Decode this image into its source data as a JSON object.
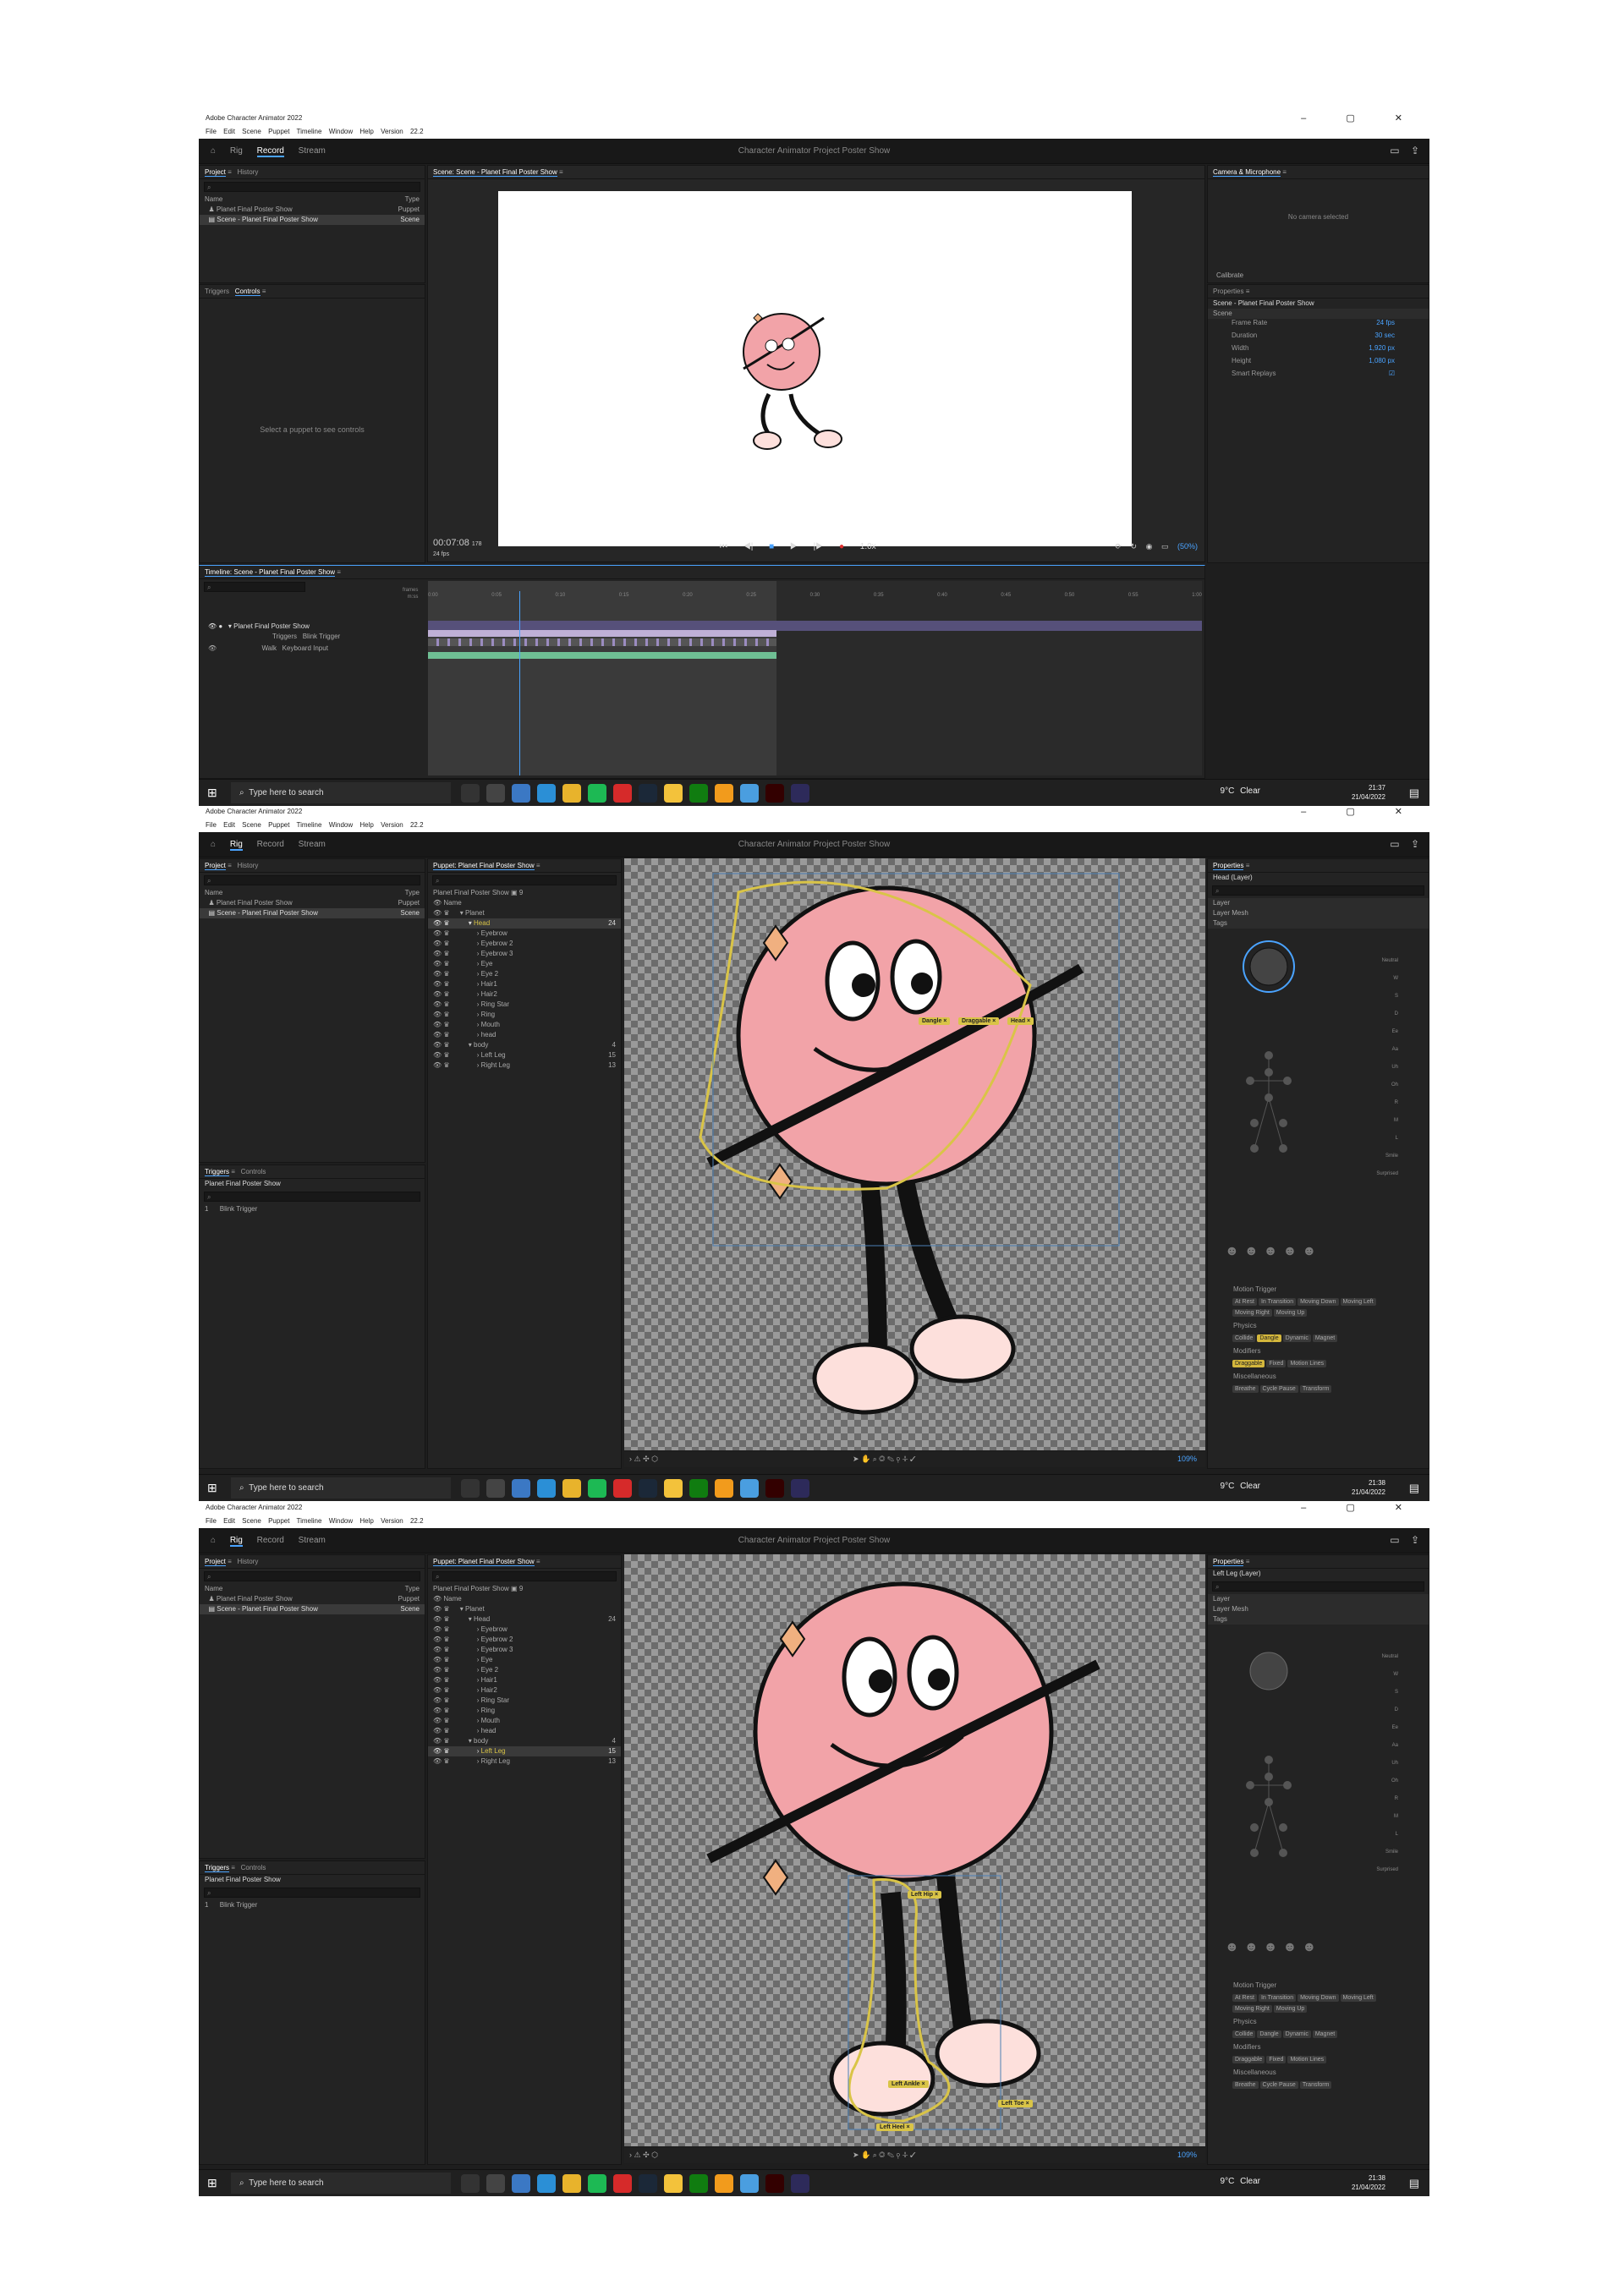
{
  "window": {
    "title": "Adobe Character Animator 2022",
    "controls": "–  ▢  ✕"
  },
  "menu": [
    "File",
    "Edit",
    "Scene",
    "Puppet",
    "Timeline",
    "Window",
    "Help",
    "Version 22.2"
  ],
  "header": {
    "tabs": [
      "Rig",
      "Record",
      "Stream"
    ],
    "project_title": "Character Animator Project Poster Show"
  },
  "project_panel": {
    "tabs": [
      "Project",
      "History"
    ],
    "col_name": "Name",
    "col_type": "Type",
    "rows": [
      {
        "name": "Planet Final Poster Show",
        "type": "Puppet"
      },
      {
        "name": "Scene - Planet Final Poster Show",
        "type": "Scene"
      }
    ]
  },
  "shot1": {
    "controls_panel": {
      "tabs": [
        "Triggers",
        "Controls"
      ],
      "message": "Select a puppet to see controls"
    },
    "scene_panel": {
      "title": "Scene: Scene - Planet Final Poster Show",
      "time": "00:07:08",
      "frame": "178",
      "fps": "24 fps",
      "speed": "1.0x",
      "zoom": "(50%)"
    },
    "camera_panel": {
      "title": "Camera & Microphone",
      "message": "No camera selected",
      "calibrate": "Calibrate"
    },
    "properties": {
      "title": "Properties",
      "scene_name": "Scene - Planet Final Poster Show",
      "section": "Scene",
      "items": [
        {
          "label": "Frame Rate",
          "value": "24 fps"
        },
        {
          "label": "Duration",
          "value": "30 sec"
        },
        {
          "label": "Width",
          "value": "1,920 px"
        },
        {
          "label": "Height",
          "value": "1,080 px"
        },
        {
          "label": "Smart Replays",
          "value": "☑"
        }
      ]
    },
    "timeline": {
      "title": "Timeline: Scene - Planet Final Poster Show",
      "frames_label": "frames",
      "time_label": "m:ss",
      "ticks": [
        "0:00",
        "0:05",
        "0:10",
        "0:15",
        "0:20",
        "0:25",
        "0:30",
        "0:35",
        "0:40",
        "0:45",
        "0:50",
        "0:55",
        "1:00"
      ],
      "tracks": [
        {
          "name": "Planet Final Poster Show"
        },
        {
          "name": "Triggers",
          "detail": "Blink Trigger"
        },
        {
          "name": "Walk",
          "detail": "Keyboard Input"
        }
      ]
    },
    "taskbar": {
      "search": "Type here to search",
      "weather": "9°C  Clear",
      "time": "21:37",
      "date": "21/04/2022"
    }
  },
  "shot2": {
    "puppet_panel": {
      "title": "Puppet: Planet Final Poster Show",
      "puppet": "Planet Final Poster Show",
      "count": "9",
      "col_name": "Name",
      "layers": [
        {
          "name": "Planet",
          "indent": 1
        },
        {
          "name": "Head",
          "indent": 2,
          "n": "24",
          "sel": true
        },
        {
          "name": "Eyebrow",
          "indent": 3
        },
        {
          "name": "Eyebrow 2",
          "indent": 3
        },
        {
          "name": "Eyebrow 3",
          "indent": 3
        },
        {
          "name": "Eye",
          "indent": 3
        },
        {
          "name": "Eye 2",
          "indent": 3
        },
        {
          "name": "Hair1",
          "indent": 3
        },
        {
          "name": "Hair2",
          "indent": 3
        },
        {
          "name": "Ring Star",
          "indent": 3
        },
        {
          "name": "Ring",
          "indent": 3
        },
        {
          "name": "Mouth",
          "indent": 3
        },
        {
          "name": "head",
          "indent": 3
        },
        {
          "name": "body",
          "indent": 2,
          "n": "4"
        },
        {
          "name": "Left Leg",
          "indent": 3,
          "n": "15"
        },
        {
          "name": "Right Leg",
          "indent": 3,
          "n": "13"
        }
      ]
    },
    "triggers_panel": {
      "tabs": [
        "Triggers",
        "Controls"
      ],
      "puppet": "Planet Final Poster Show",
      "trigger": "Blink Trigger",
      "key": "1"
    },
    "labels": [
      "Dangle ×",
      "Draggable ×",
      "Head ×"
    ],
    "properties": {
      "title": "Properties",
      "layer": "Head (Layer)",
      "sections": [
        "Layer",
        "Layer Mesh",
        "Tags"
      ],
      "face_tags": [
        "Neutral",
        "W",
        "S",
        "D",
        "Ee",
        "Aa",
        "Uh",
        "Oh",
        "R",
        "M",
        "L",
        "Smile",
        "Surprised"
      ],
      "motion_trigger": {
        "title": "Motion Trigger",
        "tags": [
          "At Rest",
          "In Transition",
          "Moving Down",
          "Moving Left",
          "Moving Right",
          "Moving Up"
        ]
      },
      "physics": {
        "title": "Physics",
        "tags": [
          "Collide",
          "Dangle",
          "Dynamic",
          "Magnet"
        ],
        "active": "Dangle"
      },
      "modifiers": {
        "title": "Modifiers",
        "tags": [
          "Draggable",
          "Fixed",
          "Motion Lines"
        ],
        "active": "Draggable"
      },
      "misc": {
        "title": "Miscellaneous",
        "tags": [
          "Breathe",
          "Cycle Pause",
          "Transform"
        ]
      }
    },
    "zoom": "109%",
    "taskbar": {
      "search": "Type here to search",
      "weather": "9°C  Clear",
      "time": "21:38",
      "date": "21/04/2022"
    }
  },
  "shot3": {
    "layers_selected": "Left Leg",
    "labels": [
      "Left Hip ×",
      "Left Ankle ×",
      "Left Toe ×",
      "Left Heel ×"
    ],
    "properties": {
      "layer": "Left Leg (Layer)"
    },
    "zoom": "109%",
    "taskbar": {
      "search": "Type here to search",
      "weather": "9°C  Clear",
      "time": "21:38",
      "date": "21/04/2022"
    }
  },
  "colors": {
    "accent": "#4aa3ff",
    "tag_active": "#d4b73c",
    "planet": "#f2a3a8",
    "record": "#e03030"
  }
}
